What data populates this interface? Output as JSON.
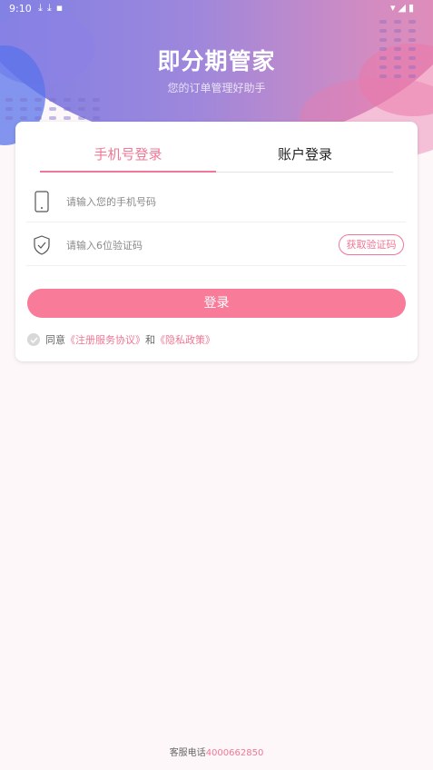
{
  "status_bar": {
    "time": "9:10",
    "left_icons": [
      "download-icon",
      "download-icon",
      "notification-icon"
    ],
    "right_icons": [
      "wifi-icon",
      "signal-icon",
      "battery-icon"
    ]
  },
  "header": {
    "title": "即分期管家",
    "subtitle": "您的订单管理好助手"
  },
  "tabs": [
    {
      "label": "手机号登录",
      "active": true
    },
    {
      "label": "账户登录",
      "active": false
    }
  ],
  "phone_field": {
    "placeholder": "请输入您的手机号码",
    "value": "",
    "icon": "phone-icon"
  },
  "code_field": {
    "placeholder": "请输入6位验证码",
    "value": "",
    "icon": "shield-check-icon",
    "button_label": "获取验证码"
  },
  "login_button": {
    "label": "登录"
  },
  "agreement": {
    "prefix": "同意",
    "terms_link": "《注册服务协议》",
    "conjunction": "和",
    "privacy_link": "《隐私政策》"
  },
  "footer": {
    "label": "客服电话",
    "phone": "4000662850"
  },
  "colors": {
    "accent": "#f07795",
    "button": "#f87b99",
    "background": "#fdf7f9"
  }
}
